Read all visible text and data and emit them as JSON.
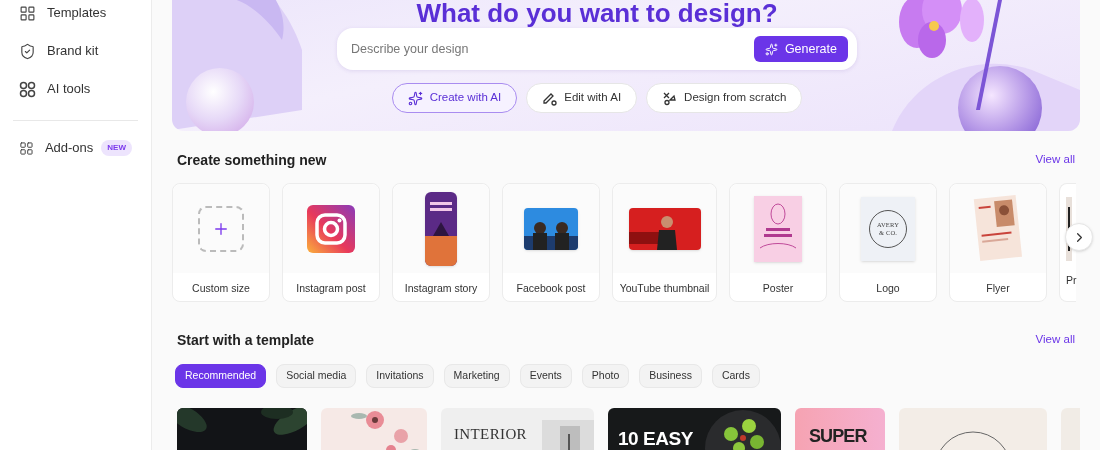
{
  "sidebar": {
    "items": [
      {
        "label": "Templates",
        "kind": "grid"
      },
      {
        "label": "Brand kit",
        "kind": "shield"
      },
      {
        "label": "AI tools",
        "kind": "circles"
      }
    ],
    "addons": {
      "label": "Add-ons",
      "badge": "NEW"
    }
  },
  "hero": {
    "heading": "What do you want to design?",
    "search": {
      "placeholder": "Describe your design"
    },
    "generate_button": "Generate",
    "modes": [
      {
        "label": "Create with AI",
        "kind": "sparkle",
        "selected": true
      },
      {
        "label": "Edit with AI",
        "kind": "edit",
        "selected": false
      },
      {
        "label": "Design from scratch",
        "kind": "scratch",
        "selected": false
      }
    ]
  },
  "create_section": {
    "title": "Create something new",
    "view_all": "View all",
    "cards": [
      {
        "label": "Custom size",
        "kind": "custom"
      },
      {
        "label": "Instagram post",
        "kind": "instagram"
      },
      {
        "label": "Instagram story",
        "kind": "story"
      },
      {
        "label": "Facebook post",
        "kind": "facebook"
      },
      {
        "label": "YouTube thumbnail",
        "kind": "youtube"
      },
      {
        "label": "Poster",
        "kind": "poster"
      },
      {
        "label": "Logo",
        "kind": "logo",
        "logo_text": [
          "AVERY",
          "& CO."
        ]
      },
      {
        "label": "Flyer",
        "kind": "flyer"
      },
      {
        "label": "Pr",
        "kind": "partial"
      }
    ]
  },
  "template_section": {
    "title": "Start with a template",
    "view_all": "View all",
    "filters": [
      {
        "label": "Recommended",
        "selected": true
      },
      {
        "label": "Social media",
        "selected": false
      },
      {
        "label": "Invitations",
        "selected": false
      },
      {
        "label": "Marketing",
        "selected": false
      },
      {
        "label": "Events",
        "selected": false
      },
      {
        "label": "Photo",
        "selected": false
      },
      {
        "label": "Business",
        "selected": false
      },
      {
        "label": "Cards",
        "selected": false
      }
    ],
    "templates": [
      {
        "kind": "leaves"
      },
      {
        "kind": "floral"
      },
      {
        "kind": "interior",
        "text": "INTERIOR"
      },
      {
        "kind": "food",
        "text": "10 EASY"
      },
      {
        "kind": "pink",
        "text": "SUPER"
      },
      {
        "kind": "circle"
      },
      {
        "kind": "partial"
      }
    ]
  }
}
